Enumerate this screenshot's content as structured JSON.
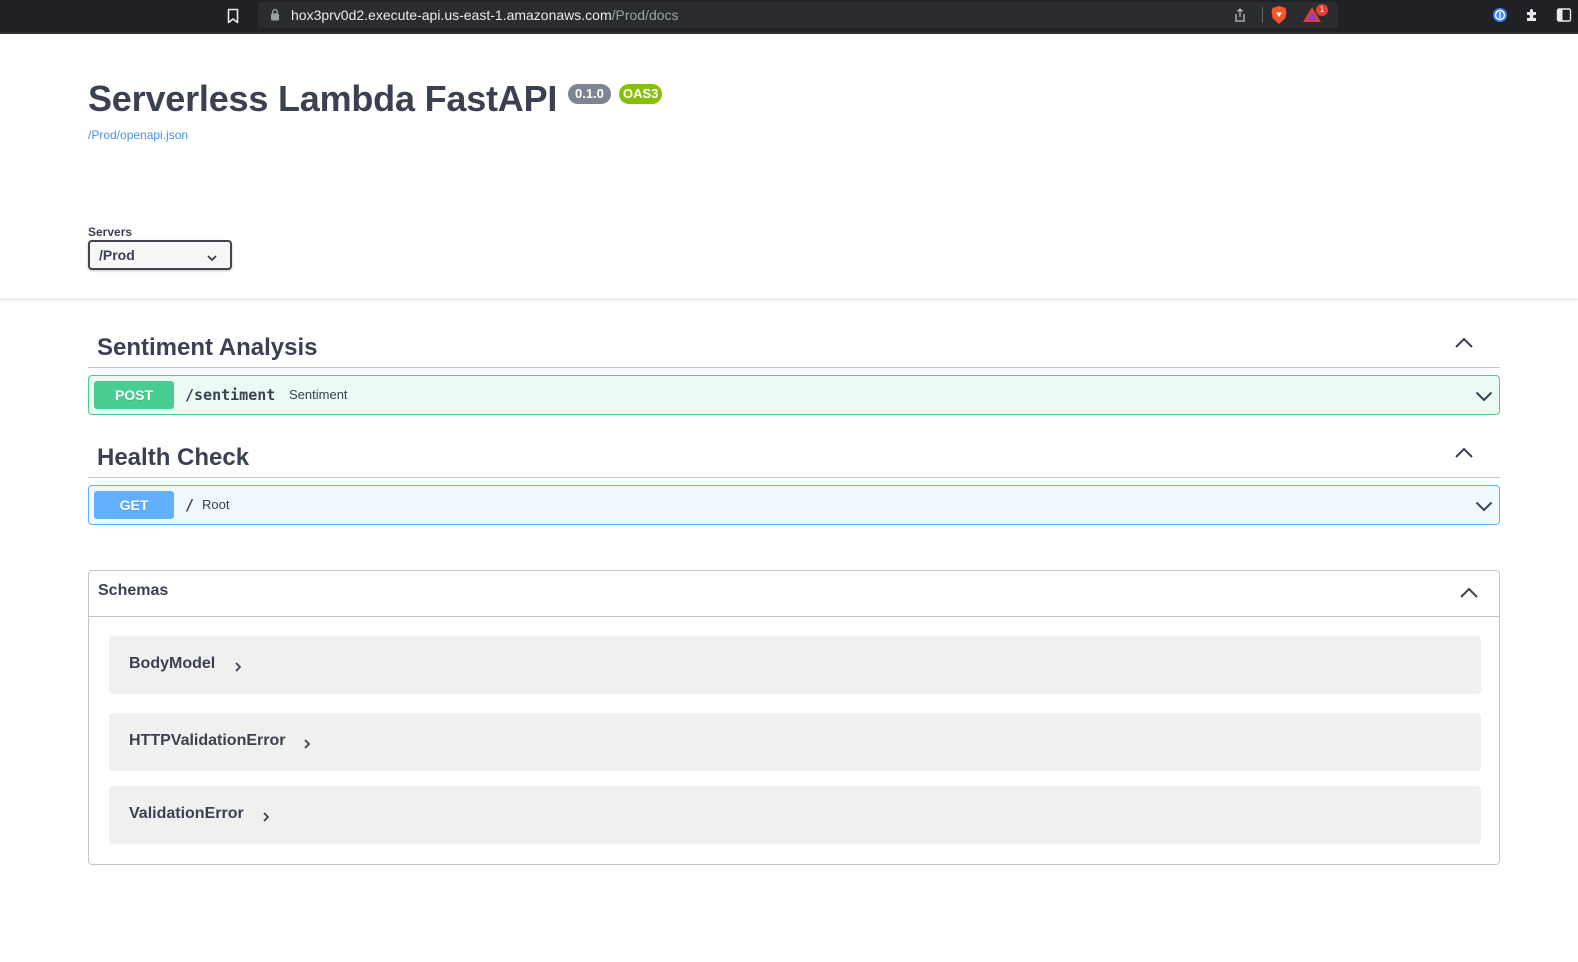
{
  "browser": {
    "url_host": "hox3prv0d2.execute-api.us-east-1.amazonaws.com",
    "url_path": "/Prod/docs",
    "notification_count": "1"
  },
  "info": {
    "title": "Serverless Lambda FastAPI",
    "version": "0.1.0",
    "oas_badge": "OAS3",
    "spec_link": "/Prod/openapi.json"
  },
  "servers": {
    "label": "Servers",
    "selected": "/Prod"
  },
  "tags": [
    {
      "name": "Sentiment Analysis",
      "operations": [
        {
          "method": "POST",
          "path": "/sentiment",
          "summary": "Sentiment"
        }
      ]
    },
    {
      "name": "Health Check",
      "operations": [
        {
          "method": "GET",
          "path": "/",
          "summary": "Root"
        }
      ]
    }
  ],
  "schemas": {
    "title": "Schemas",
    "models": [
      "BodyModel",
      "HTTPValidationError",
      "ValidationError"
    ]
  },
  "colors": {
    "post": "#49cc90",
    "get": "#61affe",
    "link": "#4990e2",
    "oas_badge": "#89bf04",
    "version_badge": "#7d8492"
  },
  "icons": [
    "bookmark-icon",
    "lock-icon",
    "share-icon",
    "brave-shield-icon",
    "brave-rewards-icon",
    "password-manager-icon",
    "extensions-icon",
    "sidebar-icon",
    "chevron-down-icon",
    "chevron-up-icon",
    "chevron-right-icon"
  ]
}
